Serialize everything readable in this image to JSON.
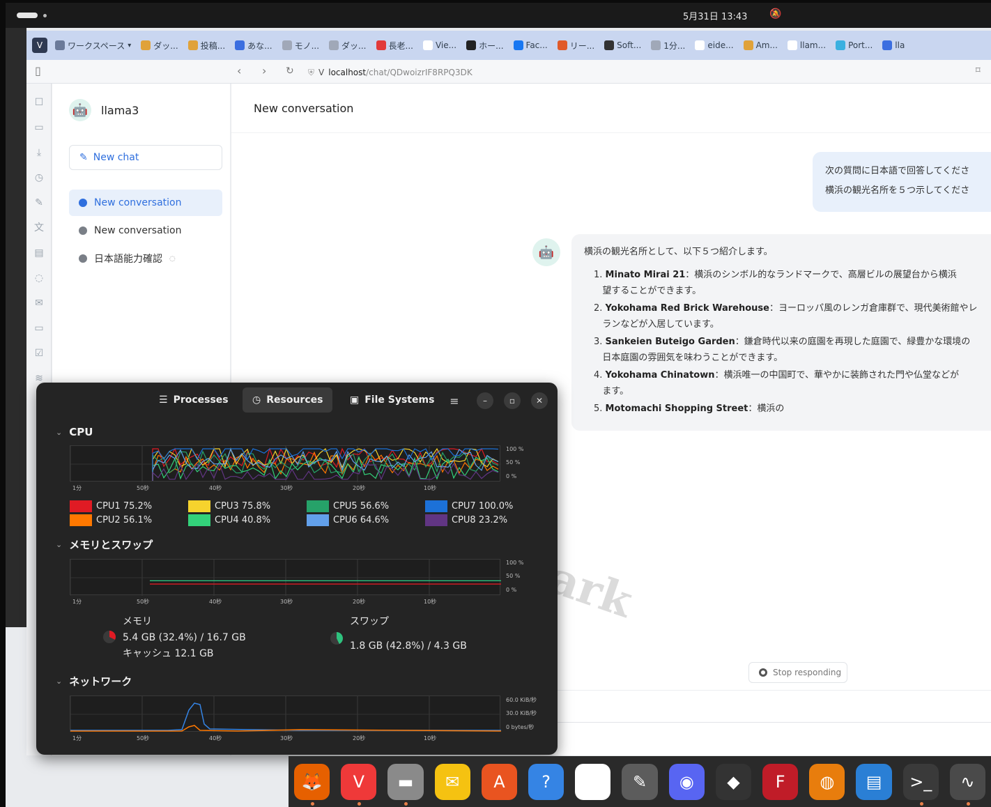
{
  "topbar": {
    "clock": "5月31日 13:43",
    "bell_icon": "bell-off-icon"
  },
  "tabs": [
    {
      "label": "ワークスペース",
      "color": "#6b7a99"
    },
    {
      "label": "ダッ...",
      "color": "#e0a23a"
    },
    {
      "label": "投稿...",
      "color": "#e0a23a"
    },
    {
      "label": "あな...",
      "color": "#3b6ee0"
    },
    {
      "label": "モノ...",
      "color": "#a0a8b8"
    },
    {
      "label": "ダッ...",
      "color": "#a0a8b8"
    },
    {
      "label": "長老...",
      "color": "#e23a3a"
    },
    {
      "label": "Vie...",
      "color": "#ffffff"
    },
    {
      "label": "ホー...",
      "color": "#222222"
    },
    {
      "label": "Fac...",
      "color": "#1877f2"
    },
    {
      "label": "リー...",
      "color": "#e05a2a"
    },
    {
      "label": "Soft...",
      "color": "#333333"
    },
    {
      "label": "1分...",
      "color": "#a0a8b8"
    },
    {
      "label": "eide...",
      "color": "#ffffff"
    },
    {
      "label": "Am...",
      "color": "#e0a23a"
    },
    {
      "label": "llam...",
      "color": "#ffffff"
    },
    {
      "label": "Port...",
      "color": "#3ab0e0"
    },
    {
      "label": "lla",
      "color": "#3b6ee0"
    }
  ],
  "address": {
    "prefix": "V",
    "host": "localhost",
    "path": "/chat/QDwoizrIF8RPQ3DK"
  },
  "sidebar": {
    "brand": "llama3",
    "new_chat": "New chat",
    "conversations": [
      "New conversation",
      "New conversation",
      "日本語能力確認"
    ]
  },
  "chat": {
    "title": "New conversation",
    "user_lines": [
      "次の質問に日本語で回答してくださ",
      "横浜の観光名所を５つ示してくださ"
    ],
    "assistant_intro": "横浜の観光名所として、以下５つ紹介します。",
    "items": [
      {
        "num": "1.",
        "name": "Minato Mirai 21",
        "line1": "：横浜のシンボル的なランドマークで、高層ビルの展望台から横浜",
        "line2": "望することができます。"
      },
      {
        "num": "2.",
        "name": "Yokohama Red Brick Warehouse",
        "line1": "：ヨーロッパ風のレンガ倉庫群で、現代美術館やレ",
        "line2": "ランなどが入居しています。"
      },
      {
        "num": "3.",
        "name": "Sankeien Buteigo Garden",
        "line1": "：鎌倉時代以来の庭園を再現した庭園で、緑豊かな環境の",
        "line2": "日本庭園の雰囲気を味わうことができます。"
      },
      {
        "num": "4.",
        "name": "Yokohama Chinatown",
        "line1": "：横浜唯一の中国町で、華やかに装飾された門や仏堂などが",
        "line2": "ます。"
      },
      {
        "num": "5.",
        "name": "Motomachi Shopping Street",
        "line1": "：横浜の",
        "line2": ""
      }
    ],
    "stop_button": "Stop responding"
  },
  "monitor": {
    "tabs": [
      "Processes",
      "Resources",
      "File Systems"
    ],
    "cpu_title": "CPU",
    "mem_title": "メモリとスワップ",
    "net_title": "ネットワーク",
    "time_ticks": [
      "1分",
      "50秒",
      "40秒",
      "30秒",
      "20秒",
      "10秒"
    ],
    "pct_ticks": [
      "100 %",
      "50 %",
      "0 %"
    ],
    "net_ticks": [
      "60.0 KiB/秒",
      "30.0 KiB/秒",
      "0 bytes/秒"
    ],
    "cpus": [
      {
        "label": "CPU1  75.2%",
        "color": "#e01b24",
        "pct": 75.2
      },
      {
        "label": "CPU2  56.1%",
        "color": "#ff7800",
        "pct": 56.1
      },
      {
        "label": "CPU3  75.8%",
        "color": "#f6d32d",
        "pct": 75.8
      },
      {
        "label": "CPU4  40.8%",
        "color": "#33d17a",
        "pct": 40.8
      },
      {
        "label": "CPU5  56.6%",
        "color": "#26a269",
        "pct": 56.6
      },
      {
        "label": "CPU6  64.6%",
        "color": "#62a0ea",
        "pct": 64.6
      },
      {
        "label": "CPU7  100.0%",
        "color": "#1c71d8",
        "pct": 100.0
      },
      {
        "label": "CPU8  23.2%",
        "color": "#613583",
        "pct": 23.2
      }
    ],
    "memory": {
      "title": "メモリ",
      "usage": "5.4 GB (32.4%) / 16.7 GB",
      "cache": "キャッシュ 12.1 GB",
      "color": "#e01b24",
      "pct": 32.4
    },
    "swap": {
      "title": "スワップ",
      "usage": "1.8 GB (42.8%) / 4.3 GB",
      "color": "#2ec27e",
      "pct": 42.8
    }
  },
  "dock": [
    {
      "name": "firefox",
      "color": "#e66000"
    },
    {
      "name": "vivaldi",
      "color": "#ef3939"
    },
    {
      "name": "files",
      "color": "#8a8a8a"
    },
    {
      "name": "mail",
      "color": "#f5c211"
    },
    {
      "name": "app-center",
      "color": "#e95420"
    },
    {
      "name": "help",
      "color": "#3584e4"
    },
    {
      "name": "kde-connect",
      "color": "#ffffff"
    },
    {
      "name": "gimp",
      "color": "#5c5c5c"
    },
    {
      "name": "discord",
      "color": "#5865f2"
    },
    {
      "name": "inkscape",
      "color": "#333333"
    },
    {
      "name": "fontforge",
      "color": "#c01c28"
    },
    {
      "name": "blender",
      "color": "#e87d0d"
    },
    {
      "name": "libreoffice",
      "color": "#2a7fd5"
    },
    {
      "name": "terminal",
      "color": "#3a3a3a"
    },
    {
      "name": "system-monitor",
      "color": "#4a4a4a"
    }
  ],
  "watermark": "default watermark"
}
